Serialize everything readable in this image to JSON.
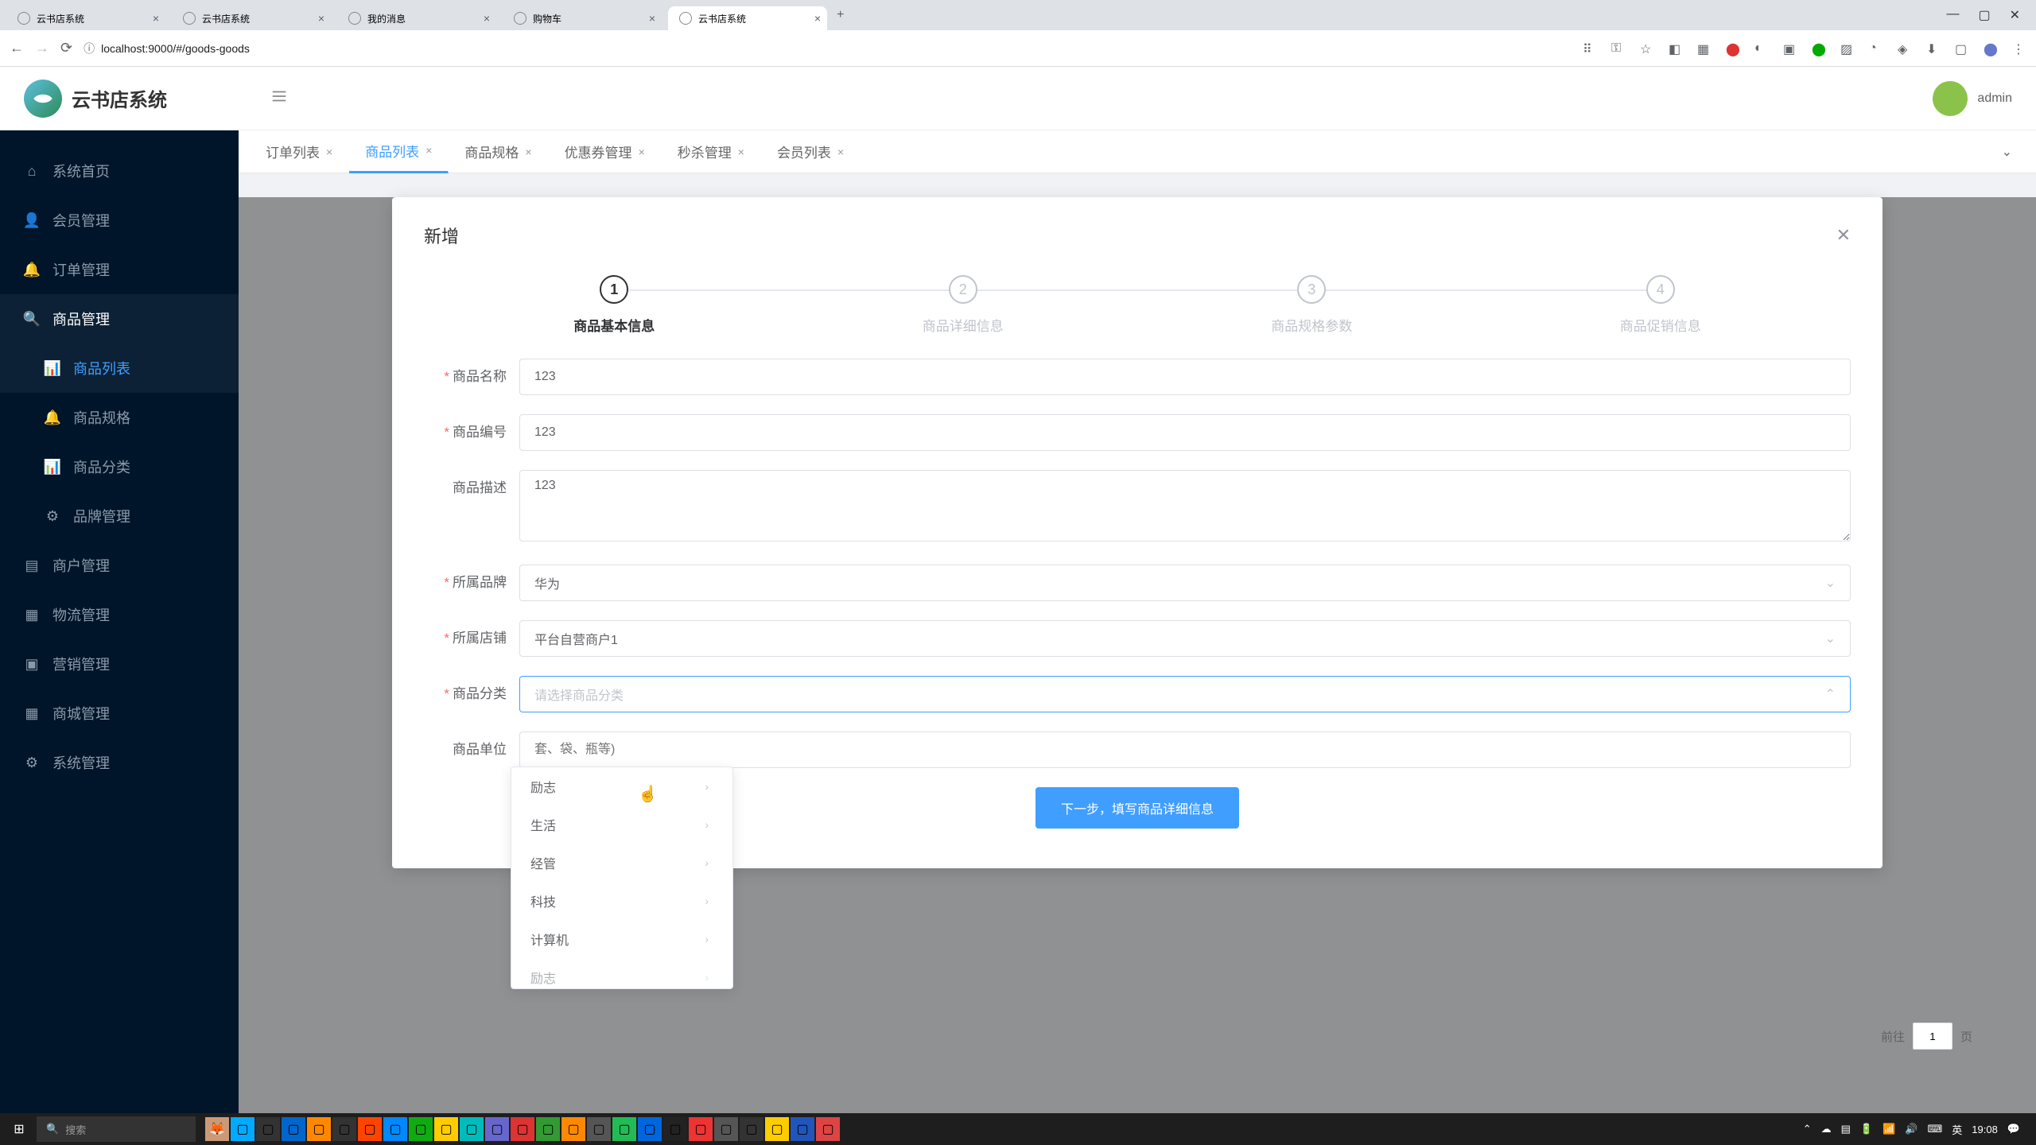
{
  "browser": {
    "tabs": [
      {
        "title": "云书店系统"
      },
      {
        "title": "云书店系统"
      },
      {
        "title": "我的消息"
      },
      {
        "title": "购物车"
      },
      {
        "title": "云书店系统"
      }
    ],
    "url": "localhost:9000/#/goods-goods"
  },
  "app": {
    "logo_text": "云书店系统",
    "username": "admin"
  },
  "sidebar": {
    "items": [
      {
        "label": "系统首页",
        "icon": "home"
      },
      {
        "label": "会员管理",
        "icon": "user"
      },
      {
        "label": "订单管理",
        "icon": "bell"
      },
      {
        "label": "商品管理",
        "icon": "search",
        "active": true,
        "children": [
          {
            "label": "商品列表",
            "active": true
          },
          {
            "label": "商品规格"
          },
          {
            "label": "商品分类"
          },
          {
            "label": "品牌管理"
          }
        ]
      },
      {
        "label": "商户管理",
        "icon": "shop"
      },
      {
        "label": "物流管理",
        "icon": "truck"
      },
      {
        "label": "营销管理",
        "icon": "tag"
      },
      {
        "label": "商城管理",
        "icon": "grid"
      },
      {
        "label": "系统管理",
        "icon": "gear"
      }
    ]
  },
  "tabs": {
    "items": [
      {
        "label": "订单列表"
      },
      {
        "label": "商品列表",
        "active": true
      },
      {
        "label": "商品规格"
      },
      {
        "label": "优惠券管理"
      },
      {
        "label": "秒杀管理"
      },
      {
        "label": "会员列表"
      }
    ]
  },
  "modal": {
    "title": "新增",
    "steps": [
      {
        "num": "1",
        "label": "商品基本信息",
        "active": true
      },
      {
        "num": "2",
        "label": "商品详细信息"
      },
      {
        "num": "3",
        "label": "商品规格参数"
      },
      {
        "num": "4",
        "label": "商品促销信息"
      }
    ],
    "form": {
      "name_label": "商品名称",
      "name_value": "123",
      "code_label": "商品编号",
      "code_value": "123",
      "desc_label": "商品描述",
      "desc_value": "123",
      "brand_label": "所属品牌",
      "brand_value": "华为",
      "shop_label": "所属店铺",
      "shop_value": "平台自营商户1",
      "category_label": "商品分类",
      "category_placeholder": "请选择商品分类",
      "unit_label": "商品单位",
      "unit_placeholder": "套、袋、瓶等)",
      "next_button": "下一步，填写商品详细信息"
    },
    "cascader": {
      "items": [
        "励志",
        "生活",
        "经管",
        "科技",
        "计算机",
        "励志"
      ]
    }
  },
  "pagination": {
    "goto": "前往",
    "page": "1",
    "unit": "页"
  },
  "taskbar": {
    "search_placeholder": "搜索",
    "time": "19:08"
  }
}
